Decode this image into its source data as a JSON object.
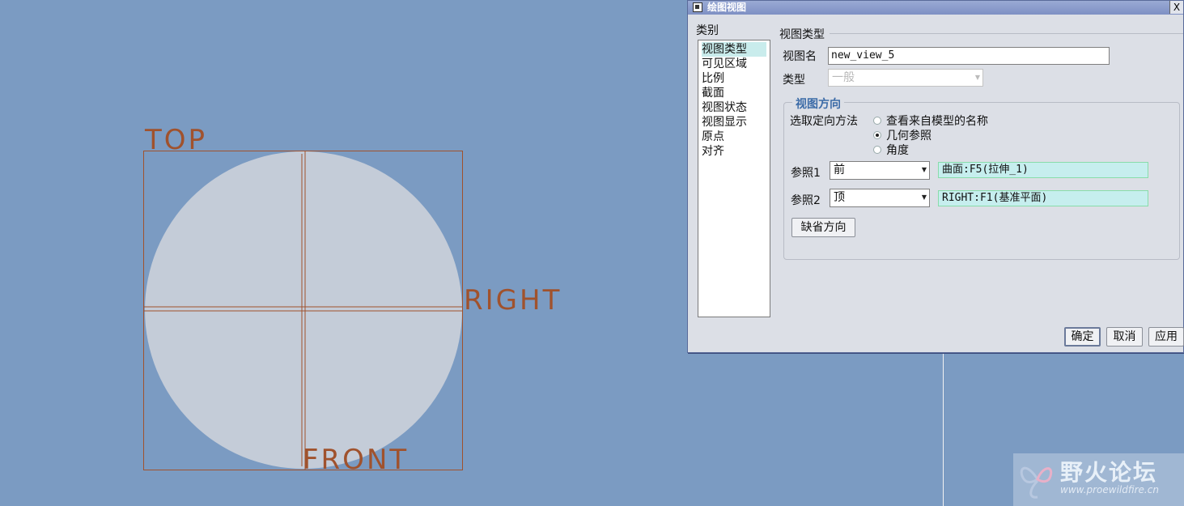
{
  "canvas": {
    "labels": {
      "top": "TOP",
      "right": "RIGHT",
      "front": "FRONT"
    },
    "colors": {
      "background": "#7b9bc2",
      "datum": "#a0522d",
      "surface": "#c4ccd8"
    }
  },
  "dialog": {
    "title": "绘图视图",
    "close_label": "X",
    "category_heading": "类别",
    "categories": [
      "视图类型",
      "可见区域",
      "比例",
      "截面",
      "视图状态",
      "视图显示",
      "原点",
      "对齐"
    ],
    "selected_category": "视图类型",
    "section_title": "视图类型",
    "view_name_label": "视图名",
    "view_name_value": "new_view_5",
    "type_label": "类型",
    "type_value": "一般",
    "orientation": {
      "legend": "视图方向",
      "method_label": "选取定向方法",
      "options": [
        "查看来自模型的名称",
        "几何参照",
        "角度"
      ],
      "selected_option": "几何参照",
      "ref1_label": "参照1",
      "ref1_value": "前",
      "ref1_selection": "曲面:F5(拉伸_1)",
      "ref2_label": "参照2",
      "ref2_value": "顶",
      "ref2_selection": "RIGHT:F1(基准平面)",
      "default_orientation_button": "缺省方向"
    },
    "buttons": {
      "ok": "确定",
      "cancel": "取消",
      "apply": "应用"
    }
  },
  "watermark": {
    "title": "野火论坛",
    "url": "www.proewildfire.cn"
  }
}
